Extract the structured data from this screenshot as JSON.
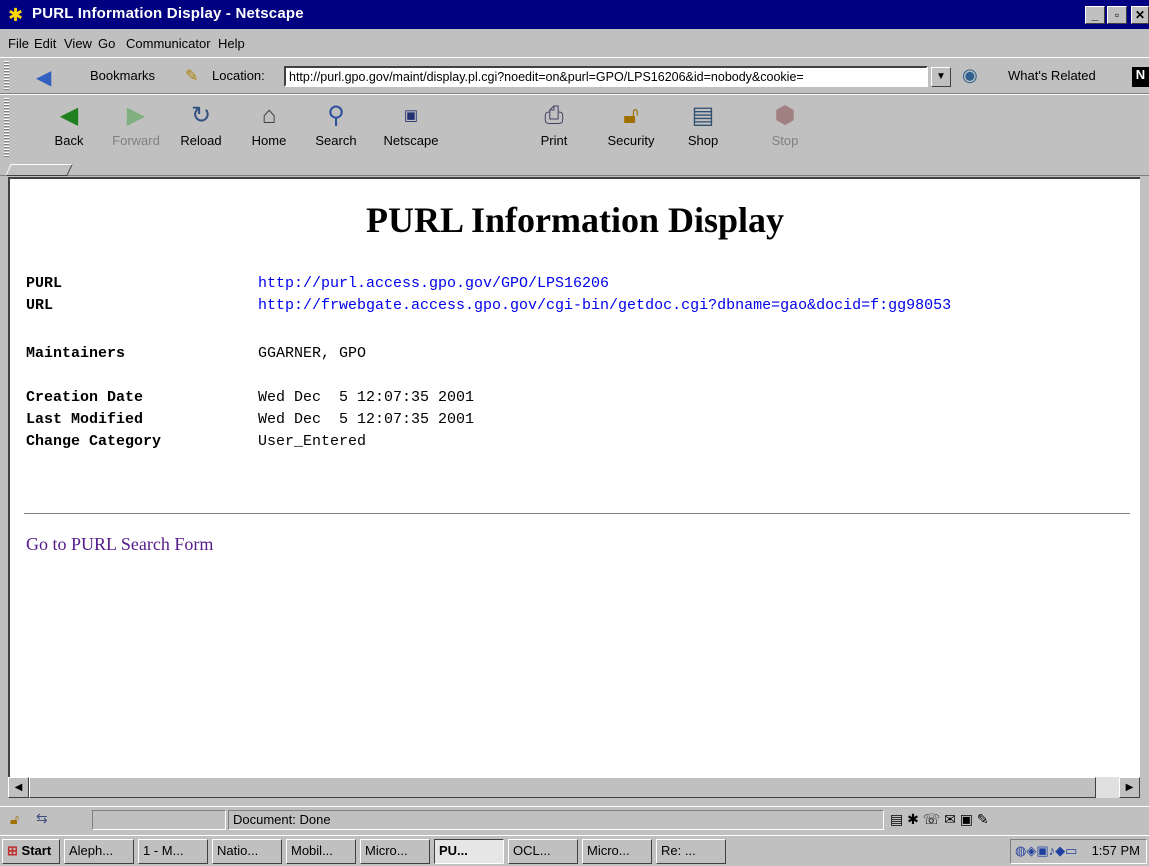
{
  "window": {
    "title": "PURL Information Display - Netscape",
    "controls": [
      "_",
      "▫",
      "✕"
    ]
  },
  "menu": [
    "File",
    "Edit",
    "View",
    "Go",
    "Communicator",
    "Help"
  ],
  "location_bar": {
    "bookmarks_label": "Bookmarks",
    "location_label": "Location:",
    "url": "http://purl.gpo.gov/maint/display.pl.cgi?noedit=on&purl=GPO/LPS16206&id=nobody&cookie=",
    "whats_related_label": "What's Related"
  },
  "toolbar": {
    "buttons": [
      {
        "label": "Back",
        "icon": "back-arrow-icon"
      },
      {
        "label": "Forward",
        "icon": "forward-arrow-icon"
      },
      {
        "label": "Reload",
        "icon": "reload-icon"
      },
      {
        "label": "Home",
        "icon": "home-icon"
      },
      {
        "label": "Search",
        "icon": "search-icon"
      },
      {
        "label": "Netscape",
        "icon": "netscape-icon"
      },
      {
        "label": "Print",
        "icon": "print-icon"
      },
      {
        "label": "Security",
        "icon": "lock-icon"
      },
      {
        "label": "Shop",
        "icon": "shop-icon"
      },
      {
        "label": "Stop",
        "icon": "stop-icon"
      }
    ]
  },
  "page": {
    "title": "PURL Information Display",
    "purl_label": "PURL",
    "purl_value": "http://purl.access.gpo.gov/GPO/LPS16206",
    "url_label": "URL",
    "url_value": "http://frwebgate.access.gpo.gov/cgi-bin/getdoc.cgi?dbname=gao&docid=f:gg98053",
    "maintainers_label": "Maintainers",
    "maintainers_value": "GGARNER, GPO",
    "creation_label": "Creation Date",
    "creation_value": "Wed Dec  5 12:07:35 2001",
    "modified_label": "Last Modified",
    "modified_value": "Wed Dec  5 12:07:35 2001",
    "category_label": "Change Category",
    "category_value": "User_Entered",
    "search_link": "Go to PURL Search Form"
  },
  "status": {
    "text": "Document: Done"
  },
  "taskbar": {
    "start_label": "Start",
    "items": [
      "Aleph...",
      "1 - M...",
      "Natio...",
      "Mobil...",
      "Micro...",
      "PU...",
      "OCL...",
      "Micro...",
      "Re: ..."
    ],
    "clock": "1:57 PM"
  },
  "colors": {
    "titlebar": "#000080",
    "link": "#0000ee",
    "visited_link": "#551a8b",
    "chrome": "#c0c0c0"
  }
}
